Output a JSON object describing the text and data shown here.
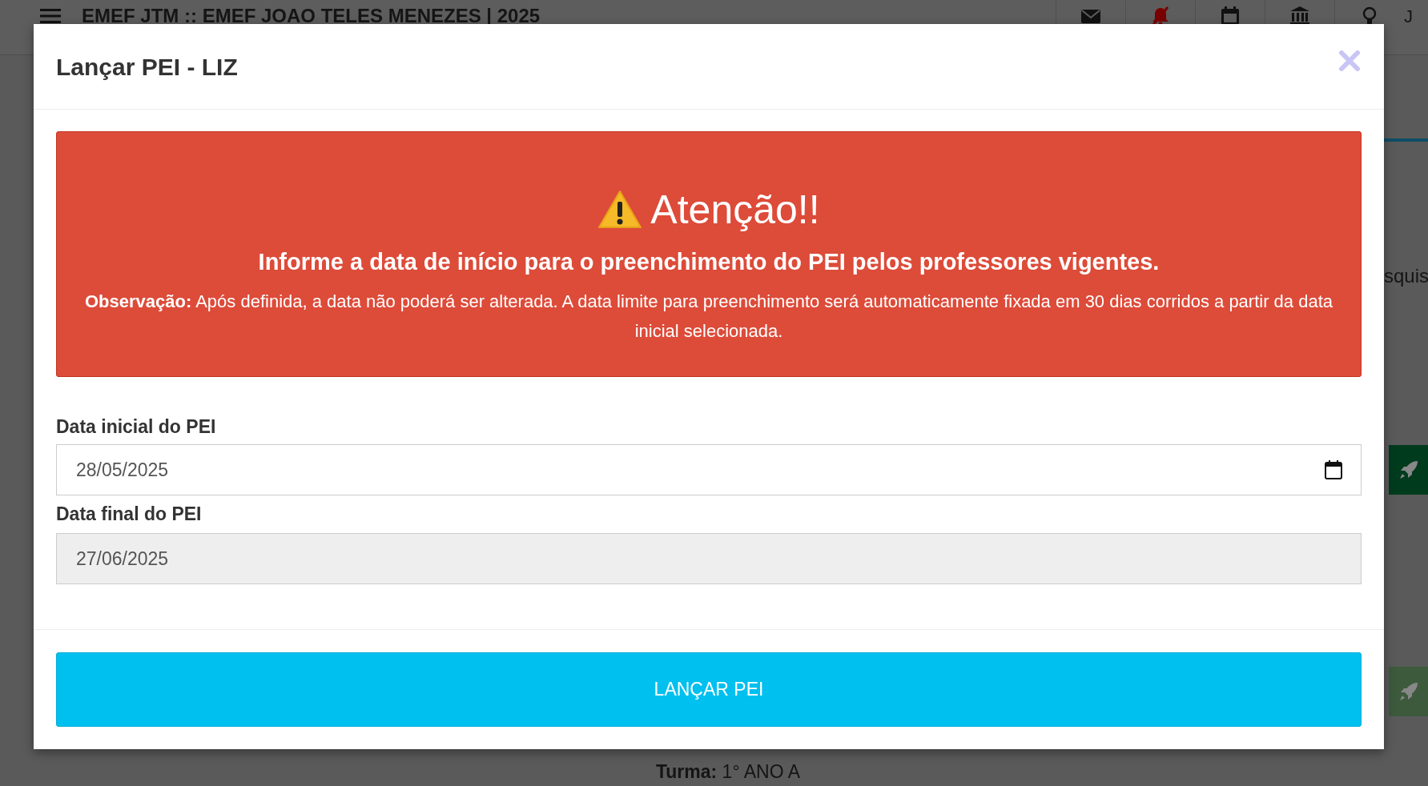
{
  "topbar": {
    "title": "EMEF JTM :: EMEF JOAO TELES MENEZES | 2025",
    "user_initial": "J"
  },
  "background": {
    "search_text": "squis",
    "turma_label": "Turma:",
    "turma_value": "1° ANO A"
  },
  "modal": {
    "title": "Lançar PEI - LIZ",
    "alert": {
      "heading": "Atenção!!",
      "message": "Informe a data de início para o preenchimento do PEI pelos professores vigentes.",
      "note": "**Observação:** Após definida, a data não poderá ser alterada. A data limite para preenchimento será automaticamente fixada em 30 dias corridos a partir da data inicial selecionada."
    },
    "fields": [
      {
        "label": "Data inicial do PEI",
        "value": "28/05/2025",
        "disabled": false
      },
      {
        "label": "Data final do PEI",
        "value": "27/06/2025",
        "disabled": true
      }
    ],
    "submit": "LANÇAR PEI"
  }
}
